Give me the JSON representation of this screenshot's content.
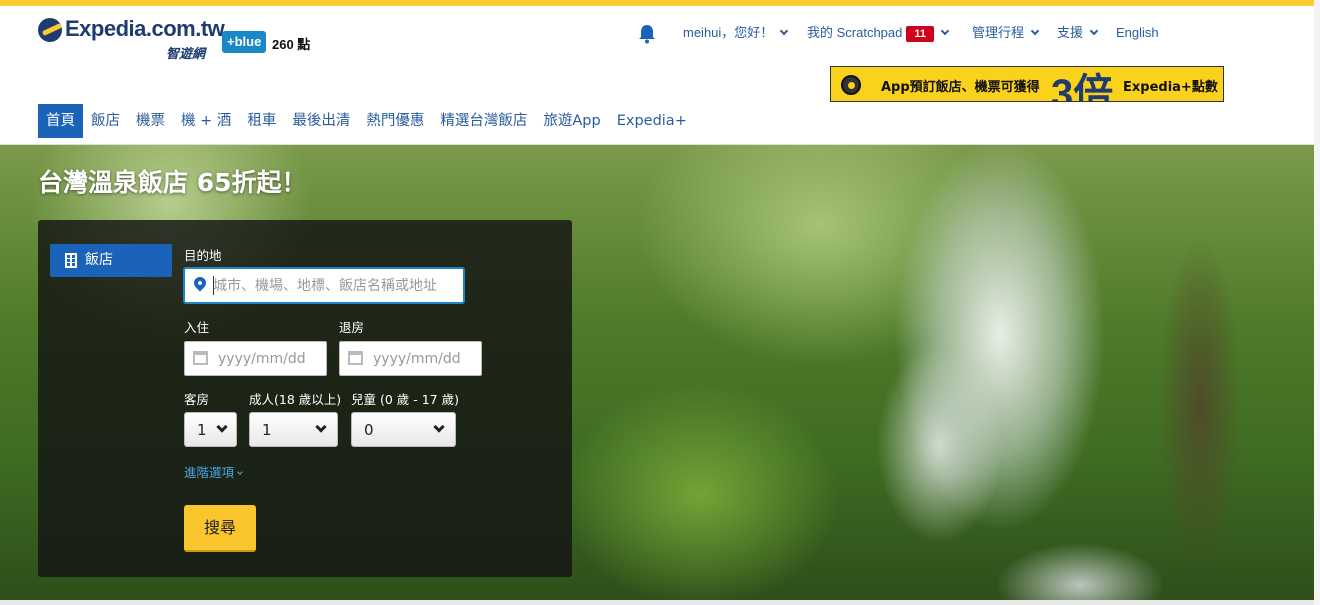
{
  "header": {
    "logo_text": "Expedia.com.tw",
    "logo_sub": "智遊網",
    "blue_badge": "+blue",
    "points": "260 點",
    "top_nav": {
      "greeting": "meihui，您好！",
      "scratchpad_label": "我的 Scratchpad",
      "scratchpad_count": "11",
      "manage_trips": "管理行程",
      "support": "支援",
      "language": "English"
    },
    "promo": {
      "text1": "App預訂飯店、機票可獲得",
      "big": "3倍",
      "text2": "Expedia+點數"
    }
  },
  "main_nav": {
    "items": [
      "首頁",
      "飯店",
      "機票",
      "機 + 酒",
      "租車",
      "最後出清",
      "熱門優惠",
      "精選台灣飯店",
      "旅遊App",
      "Expedia+"
    ],
    "active_index": 0
  },
  "hero": {
    "title": "台灣溫泉飯店 65折起！"
  },
  "search": {
    "tab_label": "飯店",
    "destination_label": "目的地",
    "destination_placeholder": "城市、機場、地標、飯店名稱或地址",
    "checkin_label": "入住",
    "checkout_label": "退房",
    "date_placeholder": "yyyy/mm/dd",
    "rooms_label": "客房",
    "adults_label": "成人(18 歲以上)",
    "children_label": "兒童 (0 歲 - 17 歲)",
    "rooms_value": "1",
    "adults_value": "1",
    "children_value": "0",
    "advanced_link": "進階選項",
    "search_button": "搜尋"
  },
  "colors": {
    "accent_yellow": "#fbcc33",
    "brand_blue": "#1f3c6e",
    "link_blue": "#2a5d9f",
    "active_blue": "#1a63b8",
    "badge_red": "#d0021b"
  }
}
